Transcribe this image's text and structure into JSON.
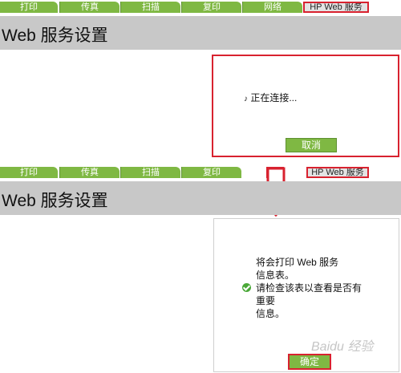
{
  "top_section": {
    "tabs": [
      {
        "label": "打印"
      },
      {
        "label": "传真"
      },
      {
        "label": "扫描"
      },
      {
        "label": "复印"
      },
      {
        "label": "网络"
      },
      {
        "label": "HP Web 服务"
      }
    ],
    "page_title": "Web 服务设置",
    "dialog": {
      "status_text": "正在连接...",
      "cancel_label": "取消"
    }
  },
  "bottom_section": {
    "tabs": [
      {
        "label": "打印"
      },
      {
        "label": "传真"
      },
      {
        "label": "扫描"
      },
      {
        "label": "复印"
      },
      {
        "label": "网络"
      },
      {
        "label": "HP Web 服务"
      }
    ],
    "page_title": "Web 服务设置",
    "dialog": {
      "message_lines": [
        "将会打印 Web 服务",
        "信息表。",
        "请检查该表以查看是否有",
        "重要",
        "信息。"
      ],
      "ok_label": "确定"
    }
  },
  "watermark_text": "Baidu 经验",
  "colors": {
    "tab_green": "#7fb843",
    "highlight_red": "#d8222f",
    "title_bar_gray": "#c8c8c8"
  }
}
